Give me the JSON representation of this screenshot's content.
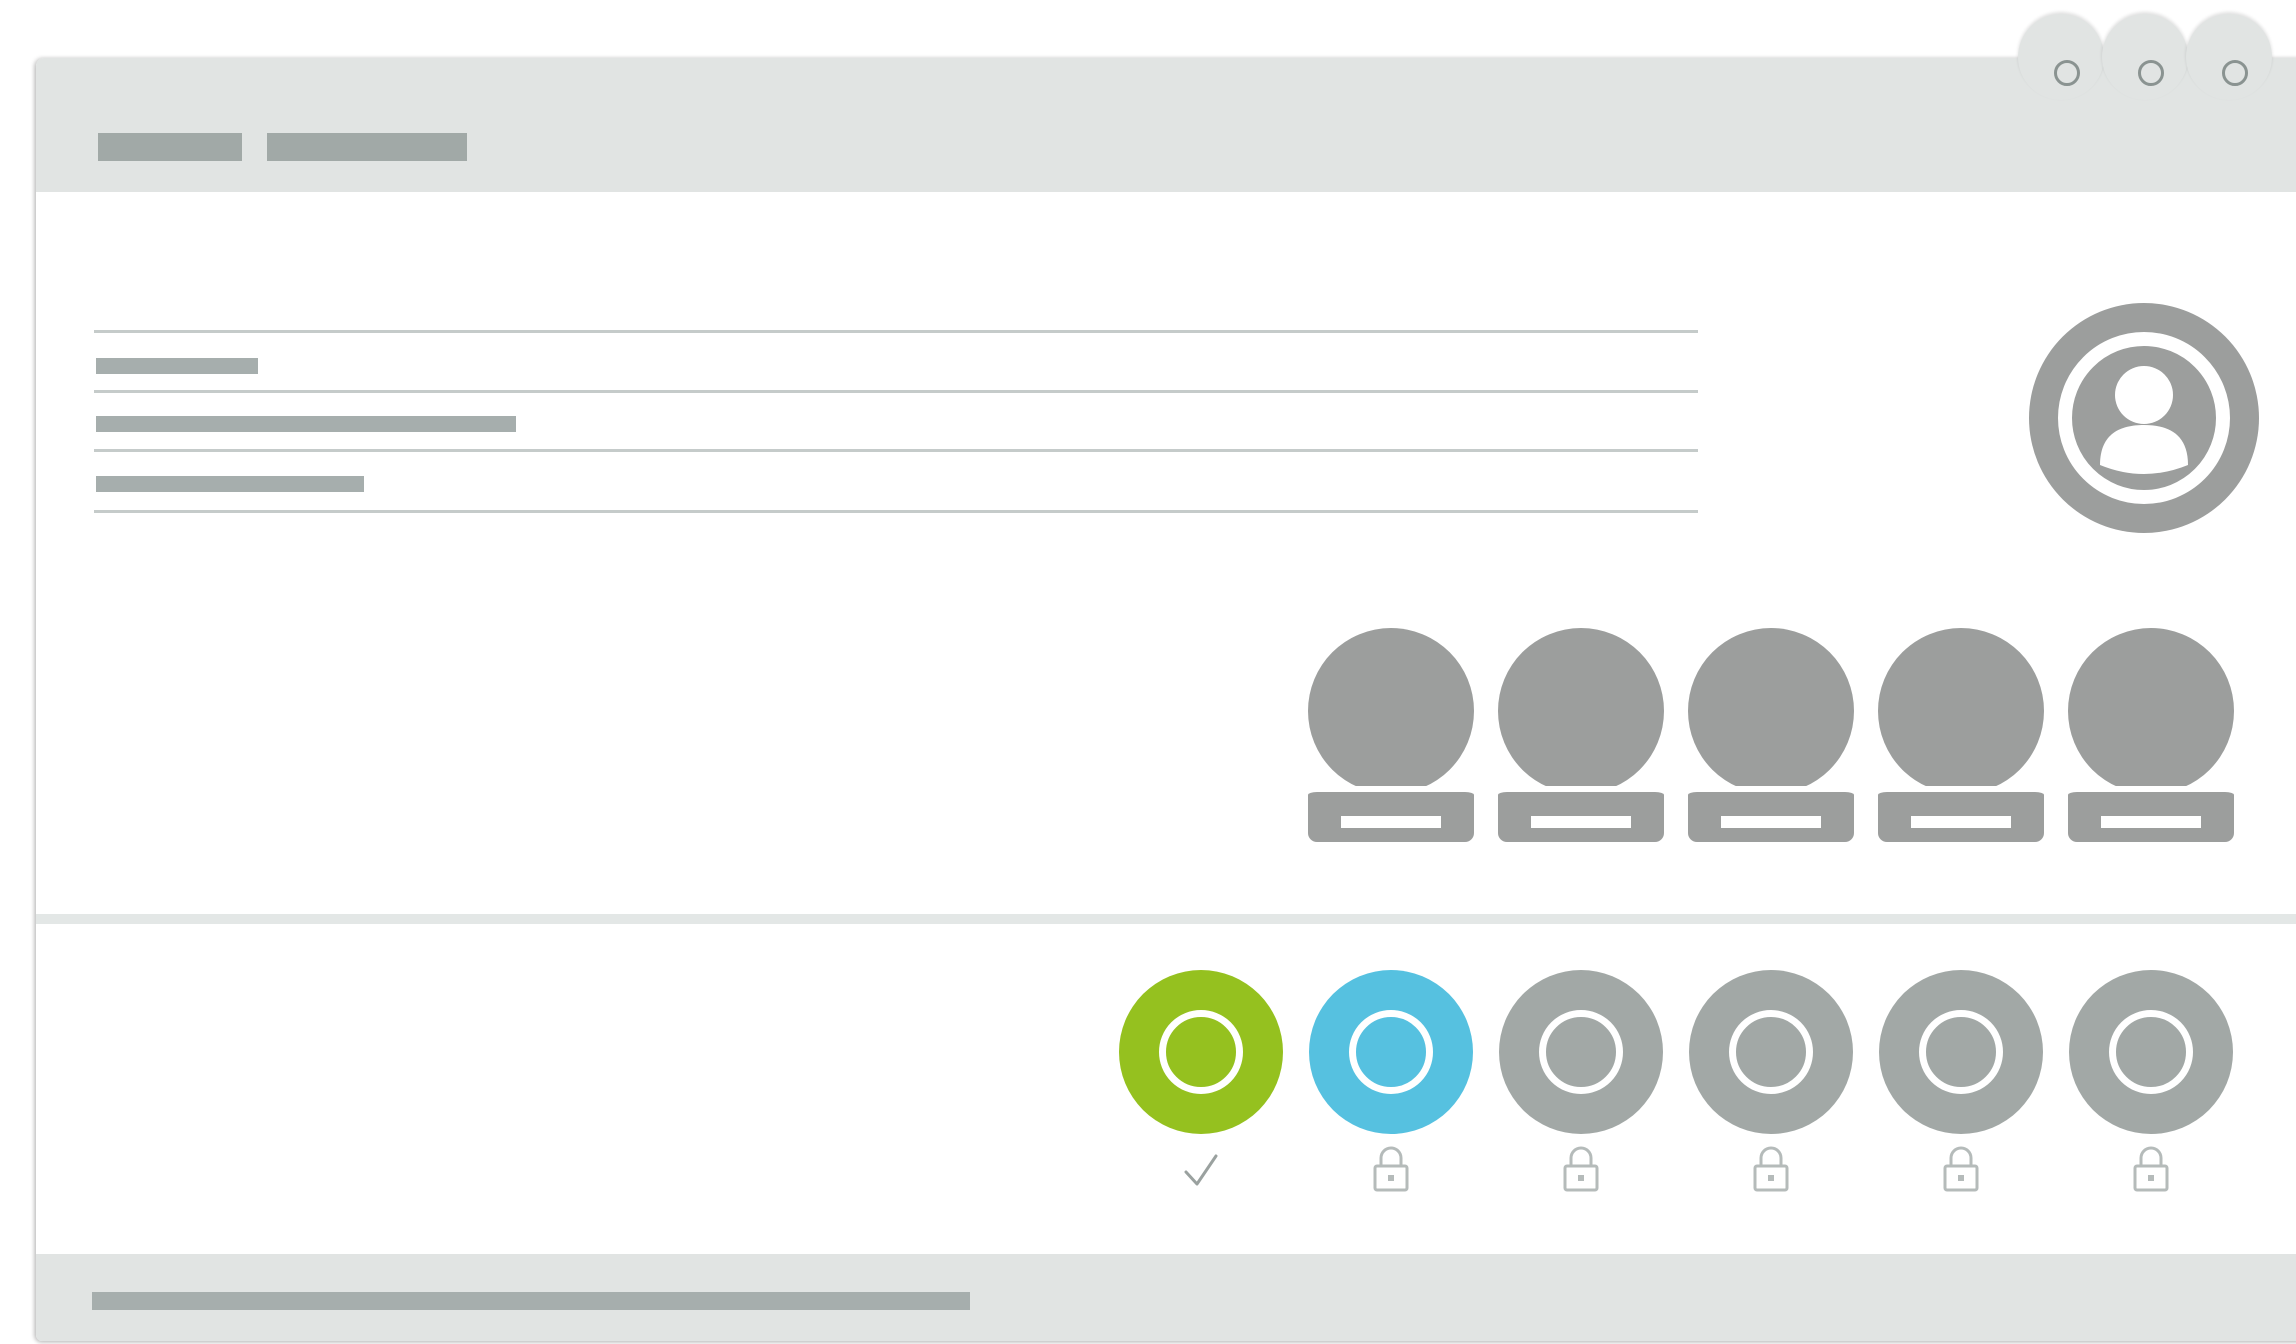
{
  "window": {
    "title_blocks": [
      "placeholder",
      "placeholder"
    ],
    "controls": [
      "circle-icon",
      "circle-icon",
      "circle-icon"
    ]
  },
  "profile": {
    "lines": 3,
    "avatar_icon": "user-profile-icon"
  },
  "people": {
    "count": 5,
    "icon": "person-on-podium-icon",
    "color": "#9c9e9d"
  },
  "levels": [
    {
      "state": "completed",
      "color": "#95c11f",
      "status_icon": "check-icon"
    },
    {
      "state": "current",
      "color": "#56c1e0",
      "status_icon": "lock-icon"
    },
    {
      "state": "locked",
      "color": "#a2a8a6",
      "status_icon": "lock-icon"
    },
    {
      "state": "locked",
      "color": "#a2a8a6",
      "status_icon": "lock-icon"
    },
    {
      "state": "locked",
      "color": "#a2a8a6",
      "status_icon": "lock-icon"
    },
    {
      "state": "locked",
      "color": "#a2a8a6",
      "status_icon": "lock-icon"
    }
  ],
  "colors": {
    "chrome": "#e1e4e3",
    "placeholder_text": "#a6aead",
    "avatar": "#9c9e9d",
    "completed": "#95c11f",
    "current": "#56c1e0",
    "locked": "#a2a8a6"
  }
}
